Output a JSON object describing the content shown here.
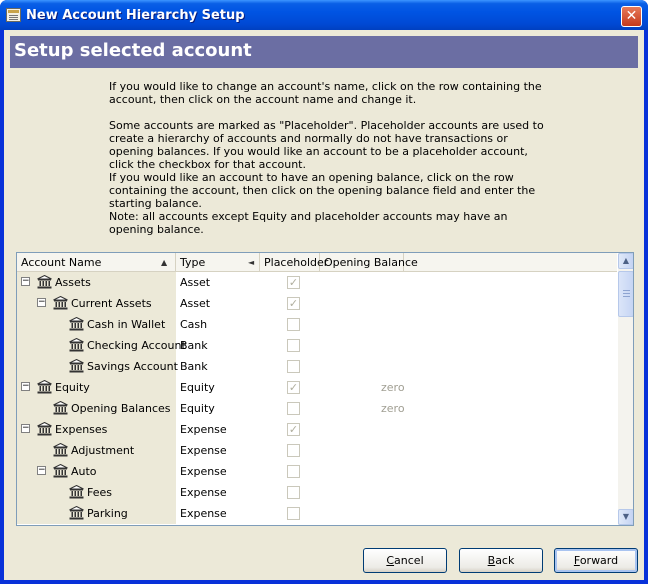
{
  "window": {
    "title": "New Account Hierarchy Setup",
    "close_glyph": "✕"
  },
  "banner": {
    "title": "Setup selected account"
  },
  "description": {
    "p1": "If you would like to change an account's name, click on the row containing the account, then click on the account name and change it.",
    "p2": "Some accounts are marked as \"Placeholder\". Placeholder accounts are used to create a hierarchy of accounts and normally do not have transactions or opening balances. If you would like an account to be a placeholder account, click the checkbox for that account.",
    "p3": "If you would like an account to have an opening balance, click on the row containing the account, then click on the opening balance field and enter the starting balance.",
    "p4": "Note: all accounts except Equity and placeholder accounts may have an opening balance."
  },
  "tree": {
    "columns": {
      "name": "Account Name",
      "type": "Type",
      "placeholder": "Placeholder",
      "opening_balance": "Opening Balance"
    },
    "sort_glyphs": {
      "name": "▲",
      "type": "◄"
    },
    "rows": [
      {
        "name": "Assets",
        "type": "Asset",
        "level": 0,
        "expander": "−",
        "placeholder": true,
        "balance": ""
      },
      {
        "name": "Current Assets",
        "type": "Asset",
        "level": 1,
        "expander": "−",
        "placeholder": true,
        "balance": ""
      },
      {
        "name": "Cash in Wallet",
        "type": "Cash",
        "level": 2,
        "expander": "",
        "placeholder": false,
        "balance": ""
      },
      {
        "name": "Checking Account",
        "type": "Bank",
        "level": 2,
        "expander": "",
        "placeholder": false,
        "balance": ""
      },
      {
        "name": "Savings Account",
        "type": "Bank",
        "level": 2,
        "expander": "",
        "placeholder": false,
        "balance": ""
      },
      {
        "name": "Equity",
        "type": "Equity",
        "level": 0,
        "expander": "−",
        "placeholder": true,
        "balance": "zero"
      },
      {
        "name": "Opening Balances",
        "type": "Equity",
        "level": 1,
        "expander": "",
        "placeholder": false,
        "balance": "zero"
      },
      {
        "name": "Expenses",
        "type": "Expense",
        "level": 0,
        "expander": "−",
        "placeholder": true,
        "balance": ""
      },
      {
        "name": "Adjustment",
        "type": "Expense",
        "level": 1,
        "expander": "",
        "placeholder": false,
        "balance": ""
      },
      {
        "name": "Auto",
        "type": "Expense",
        "level": 1,
        "expander": "−",
        "placeholder": false,
        "balance": ""
      },
      {
        "name": "Fees",
        "type": "Expense",
        "level": 2,
        "expander": "",
        "placeholder": false,
        "balance": ""
      },
      {
        "name": "Parking",
        "type": "Expense",
        "level": 2,
        "expander": "",
        "placeholder": false,
        "balance": ""
      }
    ],
    "checkmark_glyph": "✓",
    "scroll_glyphs": {
      "up": "▲",
      "down": "▼"
    }
  },
  "buttons": {
    "cancel": {
      "mnemonic": "C",
      "rest": "ancel"
    },
    "back": {
      "mnemonic": "B",
      "rest": "ack"
    },
    "forward": {
      "mnemonic": "F",
      "rest": "orward"
    }
  },
  "colors": {
    "titlebar": "#0054e3",
    "banner": "#6b6ea3",
    "dialog_bg": "#ece9d8",
    "close_button": "#c4391b"
  }
}
